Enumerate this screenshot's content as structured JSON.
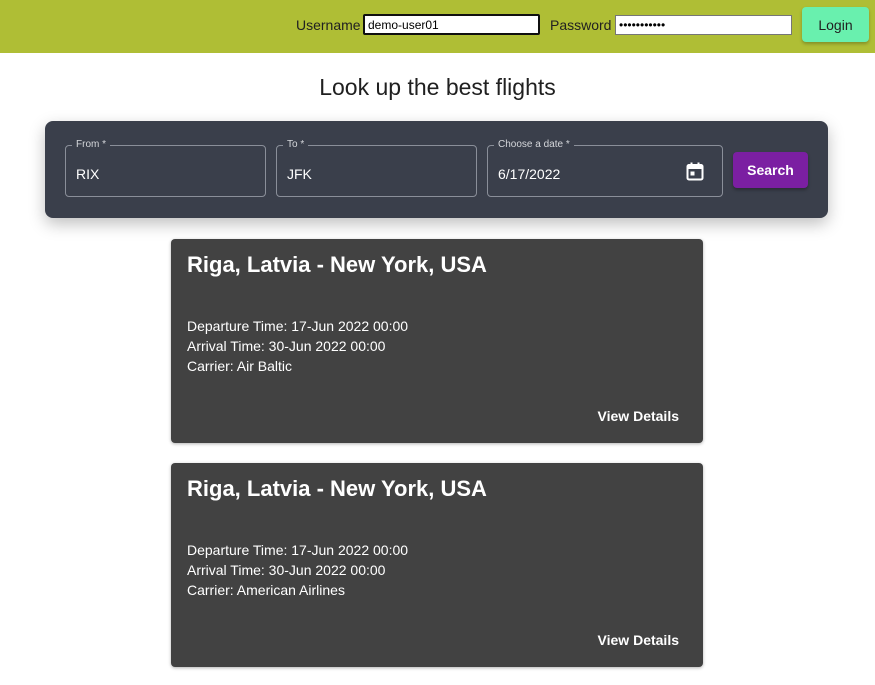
{
  "header": {
    "username_label": "Username",
    "username_value": "demo-user01",
    "password_label": "Password",
    "password_value": "•••••••••••",
    "login_label": "Login"
  },
  "page_title": "Look up the best flights",
  "search": {
    "from_label": "From *",
    "from_value": "RIX",
    "to_label": "To *",
    "to_value": "JFK",
    "date_label": "Choose a date *",
    "date_value": "6/17/2022",
    "date_icon": "calendar-icon",
    "search_label": "Search"
  },
  "results": [
    {
      "title": "Riga, Latvia - New York, USA",
      "departure": "Departure Time: 17-Jun 2022 00:00",
      "arrival": "Arrival Time: 30-Jun 2022 00:00",
      "carrier": "Carrier: Air Baltic",
      "details_label": "View Details"
    },
    {
      "title": "Riga, Latvia - New York, USA",
      "departure": "Departure Time: 17-Jun 2022 00:00",
      "arrival": "Arrival Time: 30-Jun 2022 00:00",
      "carrier": "Carrier: American Airlines",
      "details_label": "View Details"
    }
  ],
  "colors": {
    "header_bg": "#afbe35",
    "login_bg": "#69f0ae",
    "panel_bg": "#3a3f4b",
    "search_bg": "#7b1fa2",
    "card_bg": "#424242"
  }
}
